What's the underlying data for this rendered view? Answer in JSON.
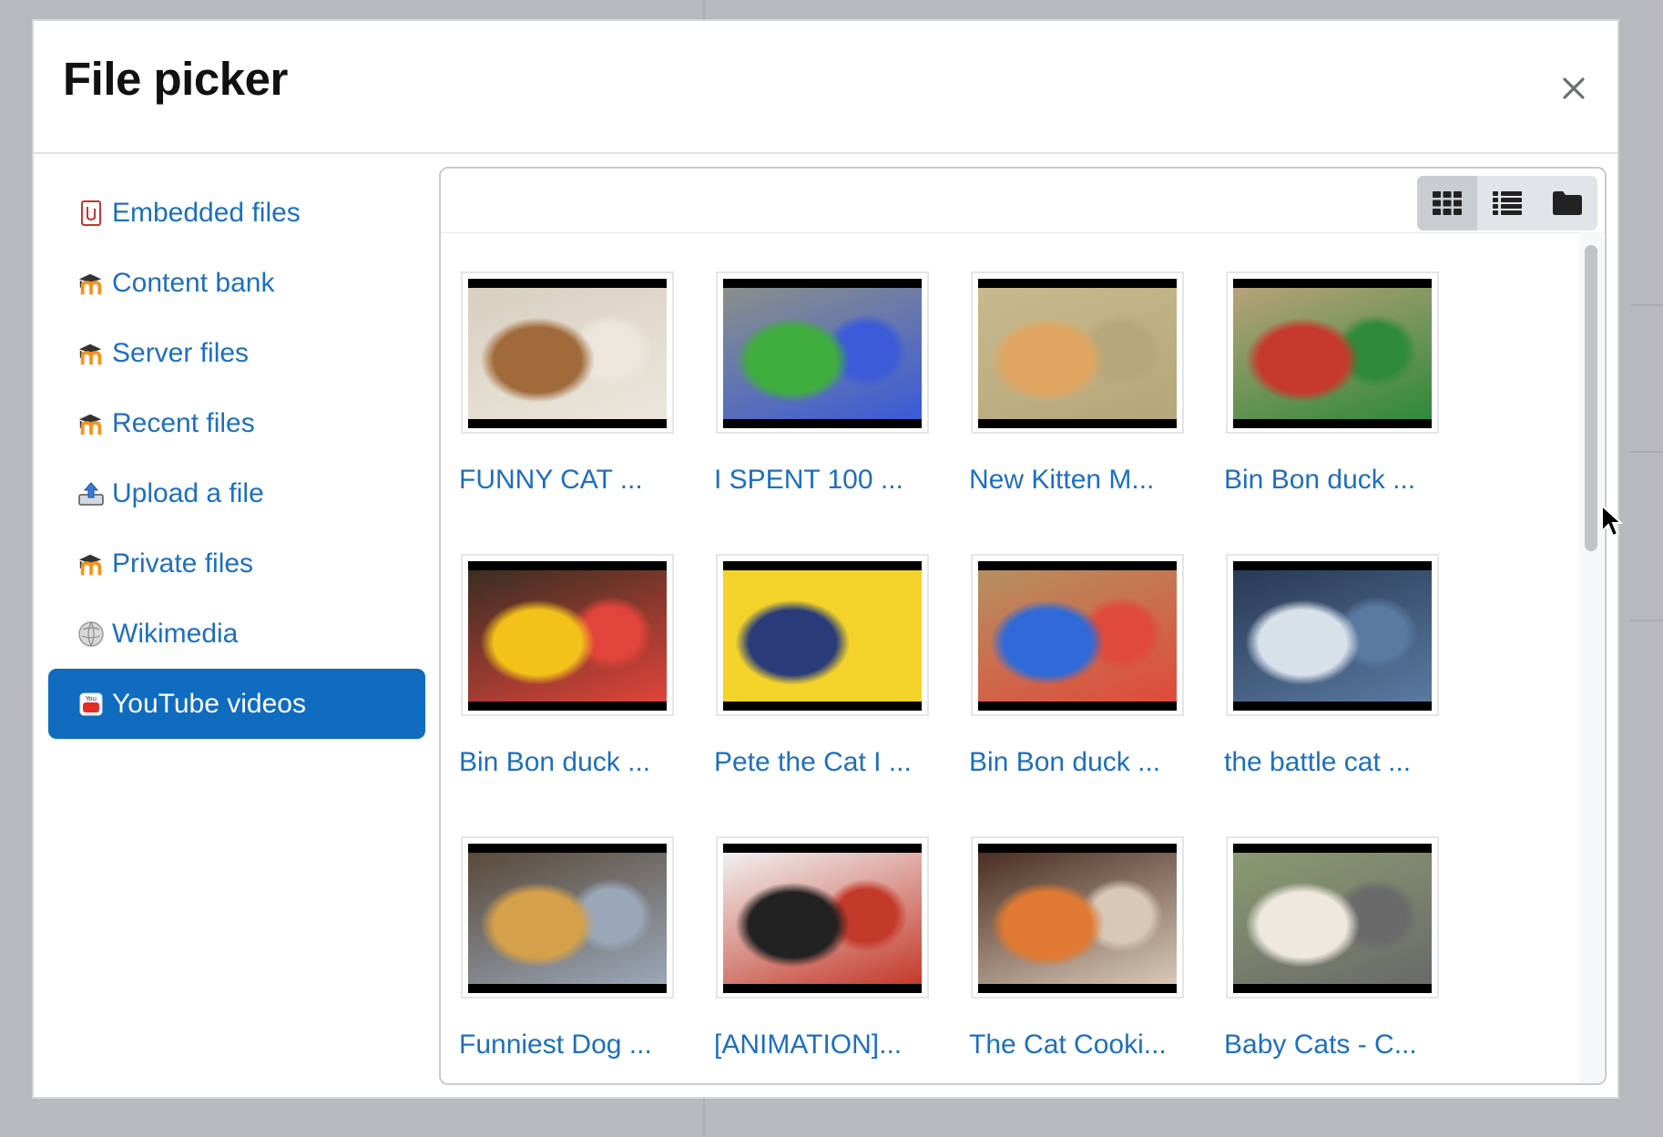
{
  "dialog": {
    "title": "File picker",
    "close_label": "×"
  },
  "sidebar": {
    "items": [
      {
        "label": "Embedded files",
        "icon": "embedded-files-icon",
        "active": false
      },
      {
        "label": "Content bank",
        "icon": "moodle-icon",
        "active": false
      },
      {
        "label": "Server files",
        "icon": "moodle-icon",
        "active": false
      },
      {
        "label": "Recent files",
        "icon": "moodle-icon",
        "active": false
      },
      {
        "label": "Upload a file",
        "icon": "upload-icon",
        "active": false
      },
      {
        "label": "Private files",
        "icon": "moodle-icon",
        "active": false
      },
      {
        "label": "Wikimedia",
        "icon": "wikimedia-icon",
        "active": false
      },
      {
        "label": "YouTube videos",
        "icon": "youtube-icon",
        "active": true
      }
    ]
  },
  "toolbar": {
    "views": [
      {
        "icon": "grid-view-icon",
        "active": true
      },
      {
        "icon": "list-view-icon",
        "active": false
      },
      {
        "icon": "folder-view-icon",
        "active": false
      }
    ]
  },
  "files": [
    {
      "label": "FUNNY CAT ...",
      "palette": [
        "#d8cfc0",
        "#a06a3a",
        "#ece6dc"
      ]
    },
    {
      "label": "I SPENT 100 ...",
      "palette": [
        "#8a8f8a",
        "#3fae3f",
        "#3b5bd8"
      ]
    },
    {
      "label": "New Kitten M...",
      "palette": [
        "#c8b98e",
        "#e0a662",
        "#b5a77a"
      ]
    },
    {
      "label": "Bin Bon duck ...",
      "palette": [
        "#b8a17a",
        "#c63a2e",
        "#2f8a3a"
      ]
    },
    {
      "label": "Bin Bon duck ...",
      "palette": [
        "#3a2e22",
        "#f2c21a",
        "#e0443a"
      ]
    },
    {
      "label": "Pete the Cat I ...",
      "palette": [
        "#f3d32a",
        "#2a3d7a",
        "#f3d32a"
      ]
    },
    {
      "label": "Bin Bon duck ...",
      "palette": [
        "#b59060",
        "#2f6ad8",
        "#e04a3a"
      ]
    },
    {
      "label": "the battle cat ...",
      "palette": [
        "#283a55",
        "#d8e0ea",
        "#5a7aa0"
      ]
    },
    {
      "label": "Funniest Dog ...",
      "palette": [
        "#5a4a3a",
        "#d4a04a",
        "#9aa7b8"
      ]
    },
    {
      "label": "[ANIMATION]...",
      "palette": [
        "#f0f0f0",
        "#222222",
        "#c43a2a"
      ]
    },
    {
      "label": "The Cat Cooki...",
      "palette": [
        "#4a2f22",
        "#e07a32",
        "#d8c8b8"
      ]
    },
    {
      "label": "Baby Cats - C...",
      "palette": [
        "#8a9a70",
        "#efe8e0",
        "#6a6a6a"
      ]
    }
  ]
}
